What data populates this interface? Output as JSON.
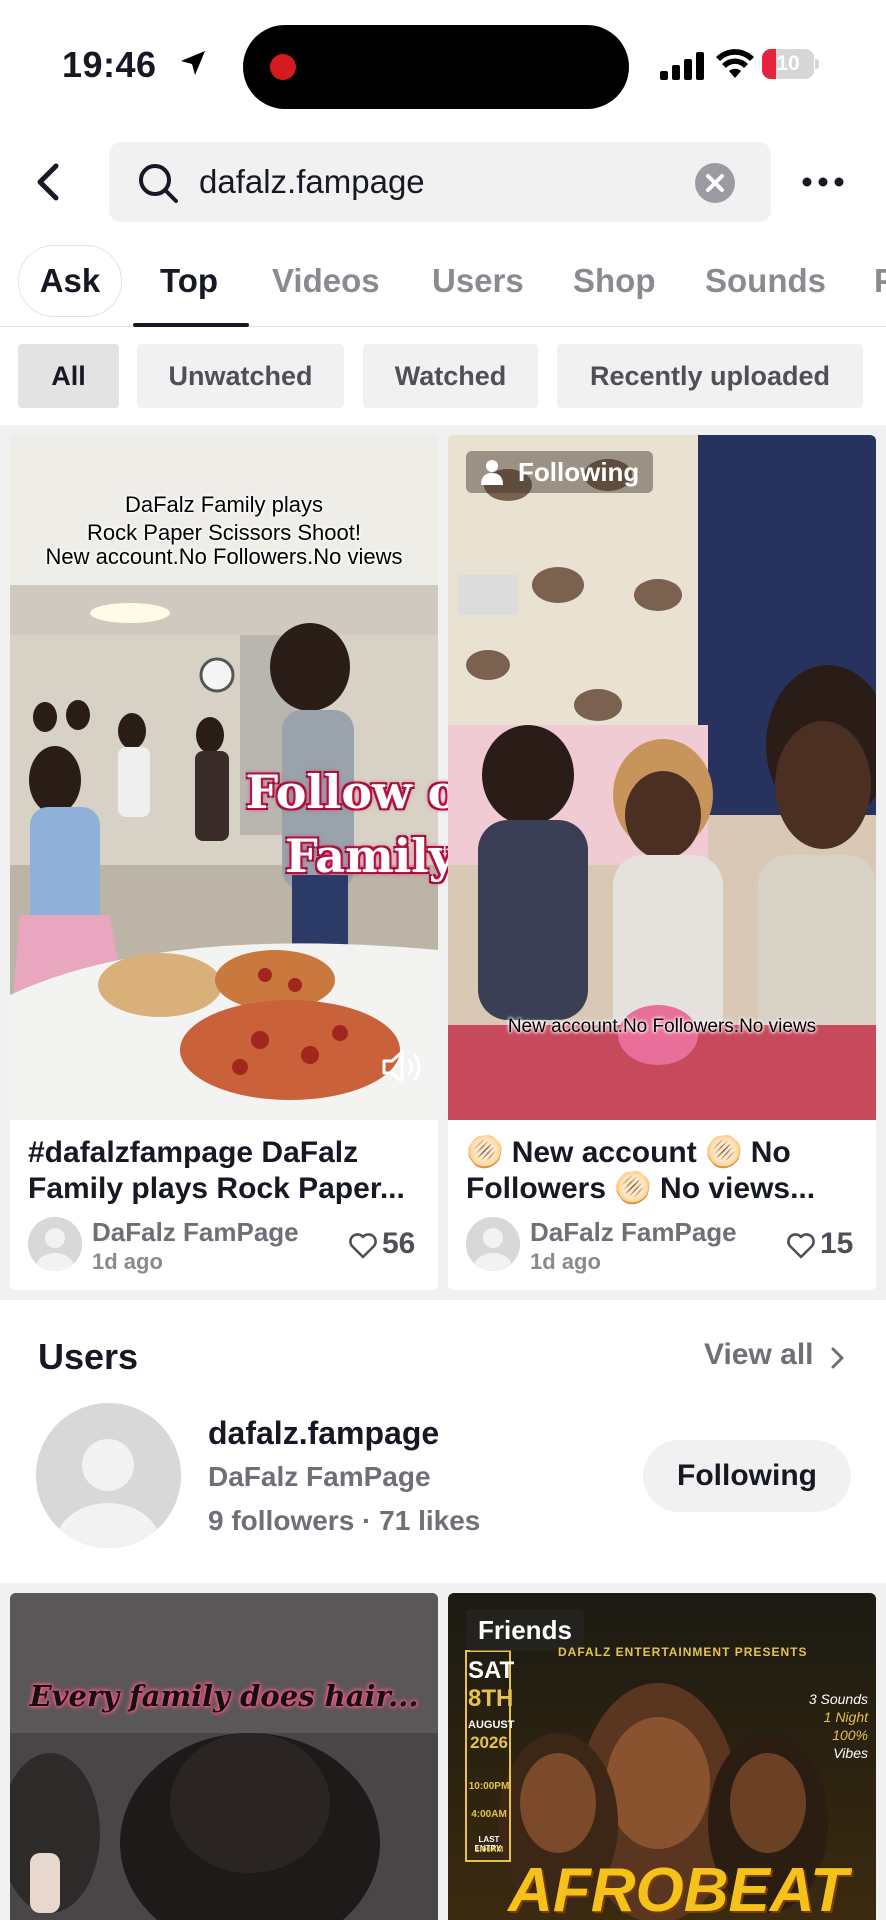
{
  "status_bar": {
    "time": "19:46",
    "battery": "10"
  },
  "search": {
    "query": "dafalz.fampage"
  },
  "tabs": [
    {
      "label": "Ask"
    },
    {
      "label": "Top"
    },
    {
      "label": "Videos"
    },
    {
      "label": "Users"
    },
    {
      "label": "Shop"
    },
    {
      "label": "Sounds"
    },
    {
      "label": "P"
    }
  ],
  "filters": [
    {
      "label": "All"
    },
    {
      "label": "Unwatched"
    },
    {
      "label": "Watched"
    },
    {
      "label": "Recently uploaded"
    }
  ],
  "videos": [
    {
      "overlay_lines": [
        "DaFalz Family plays",
        "Rock Paper Scissors Shoot!",
        "New account.No Followers.No views"
      ],
      "big_text_lines": [
        "Follow our new",
        "Family page"
      ],
      "title_lines": [
        "#dafalzfampage DaFalz",
        "Family plays Rock Paper..."
      ],
      "author": "DaFalz FamPage",
      "time": "1d ago",
      "likes": "56"
    },
    {
      "badge": "Following",
      "overlay_bottom": "New account.No Followers.No views",
      "title_lines": [
        "🫓 New account 🫓 No",
        "Followers 🫓 No views..."
      ],
      "author": "DaFalz FamPage",
      "time": "1d ago",
      "likes": "15"
    }
  ],
  "users_section": {
    "title": "Users",
    "view_all": "View all",
    "user": {
      "handle": "dafalz.fampage",
      "name": "DaFalz FamPage",
      "stats": "9 followers · 71 likes",
      "button": "Following"
    }
  },
  "more_videos": [
    {
      "overlay": "Every family does hair..."
    },
    {
      "badge": "Friends",
      "poster": {
        "presents": "DAFALZ ENTERTAINMENT PRESENTS",
        "day": "SAT",
        "date": "8TH",
        "month": "AUGUST",
        "year": "2026",
        "start": "10:00PM",
        "end": "4:00AM",
        "last_entry_label": "LAST ENTRY:",
        "last_entry_time": "1:00AM",
        "side_lines": [
          "3 Sounds",
          "1 Night",
          "100%",
          "Vibes"
        ],
        "headline": "AFROBEAT"
      }
    }
  ]
}
